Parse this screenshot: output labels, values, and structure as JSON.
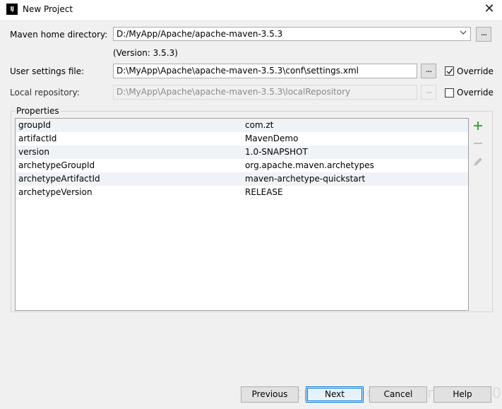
{
  "window": {
    "title": "New Project",
    "app_icon_text": "IJ"
  },
  "maven_home": {
    "label": "Maven home directory:",
    "value": "D:/MyApp/Apache/apache-maven-3.5.3",
    "version": "(Version: 3.5.3)"
  },
  "user_settings": {
    "label": "User settings file:",
    "value": "D:\\MyApp\\Apache\\apache-maven-3.5.3\\conf\\settings.xml",
    "browse": "...",
    "override_label": "Override",
    "override_checked": true
  },
  "local_repo": {
    "label": "Local repository:",
    "value": "D:\\MyApp\\Apache\\apache-maven-3.5.3\\localRepository",
    "browse": "...",
    "override_label": "Override",
    "override_checked": false
  },
  "properties": {
    "title": "Properties",
    "rows": [
      {
        "key": "groupId",
        "value": "com.zt"
      },
      {
        "key": "artifactId",
        "value": "MavenDemo"
      },
      {
        "key": "version",
        "value": "1.0-SNAPSHOT"
      },
      {
        "key": "archetypeGroupId",
        "value": "org.apache.maven.archetypes"
      },
      {
        "key": "archetypeArtifactId",
        "value": "maven-archetype-quickstart"
      },
      {
        "key": "archetypeVersion",
        "value": "RELEASE"
      }
    ]
  },
  "buttons": {
    "previous": "Previous",
    "next": "Next",
    "cancel": "Cancel",
    "help": "Help",
    "browse": "..."
  },
  "icons": {
    "add": "plus-icon",
    "remove": "minus-icon",
    "edit": "pencil-icon",
    "close": "close-icon"
  },
  "colors": {
    "add_icon": "#3aa63a",
    "primary_border": "#0078d7",
    "alt_row": "#eff3f8"
  },
  "watermark": "https://blog.csdn.net/u010..540"
}
